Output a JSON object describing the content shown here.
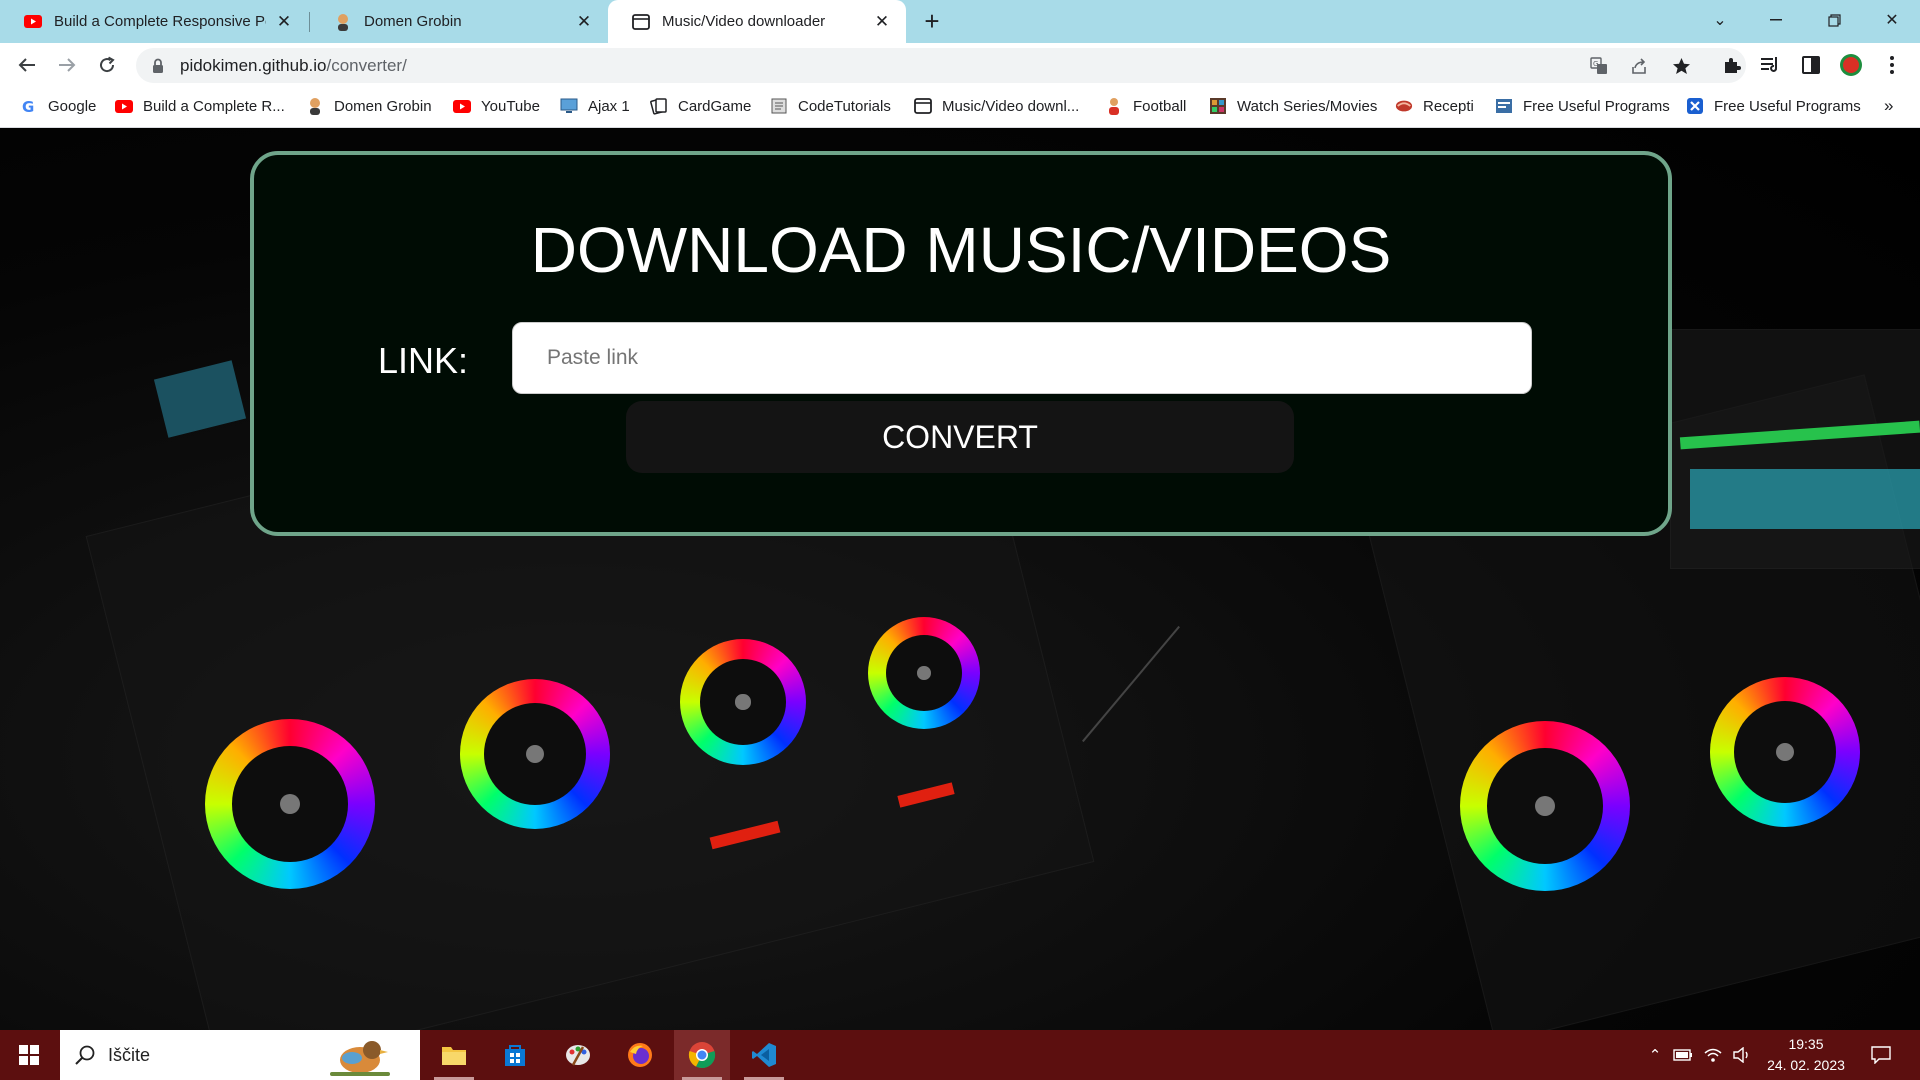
{
  "browser": {
    "tabs": [
      {
        "title": "Build a Complete Responsive Per",
        "favicon": "youtube-icon",
        "active": false
      },
      {
        "title": "Domen Grobin",
        "favicon": "avatar-icon",
        "active": false
      },
      {
        "title": "Music/Video downloader",
        "favicon": "page-icon",
        "active": true
      }
    ],
    "url_host": "pidokimen.github.io",
    "url_path": "/converter/",
    "bookmarks": [
      {
        "label": "Google",
        "icon": "google-icon"
      },
      {
        "label": "Build a Complete R...",
        "icon": "youtube-icon"
      },
      {
        "label": "Domen Grobin",
        "icon": "avatar-icon"
      },
      {
        "label": "YouTube",
        "icon": "youtube-icon"
      },
      {
        "label": "Ajax 1",
        "icon": "monitor-icon"
      },
      {
        "label": "CardGame",
        "icon": "card-icon"
      },
      {
        "label": "CodeTutorials",
        "icon": "book-icon"
      },
      {
        "label": "Music/Video downl...",
        "icon": "page-icon"
      },
      {
        "label": "Football",
        "icon": "person-icon"
      },
      {
        "label": "Watch Series/Movies",
        "icon": "film-icon"
      },
      {
        "label": "Recepti",
        "icon": "food-icon"
      },
      {
        "label": "Free Useful Programs",
        "icon": "program-icon"
      },
      {
        "label": "Free Useful Programs",
        "icon": "x-program-icon"
      }
    ],
    "overflow_label": "»"
  },
  "page": {
    "title": "DOWNLOAD MUSIC/VIDEOS",
    "link_label": "LINK:",
    "link_placeholder": "Paste link",
    "link_value": "",
    "convert_label": "CONVERT"
  },
  "taskbar": {
    "search_text": "Iščite",
    "time": "19:35",
    "date": "24. 02. 2023",
    "apps": [
      "file-explorer-icon",
      "store-icon",
      "paint-icon",
      "firefox-icon",
      "chrome-icon",
      "vscode-icon"
    ]
  },
  "colors": {
    "tabstrip": "#a8dbe8",
    "card_border": "#6fa58a",
    "taskbar": "#5c0f0f"
  }
}
